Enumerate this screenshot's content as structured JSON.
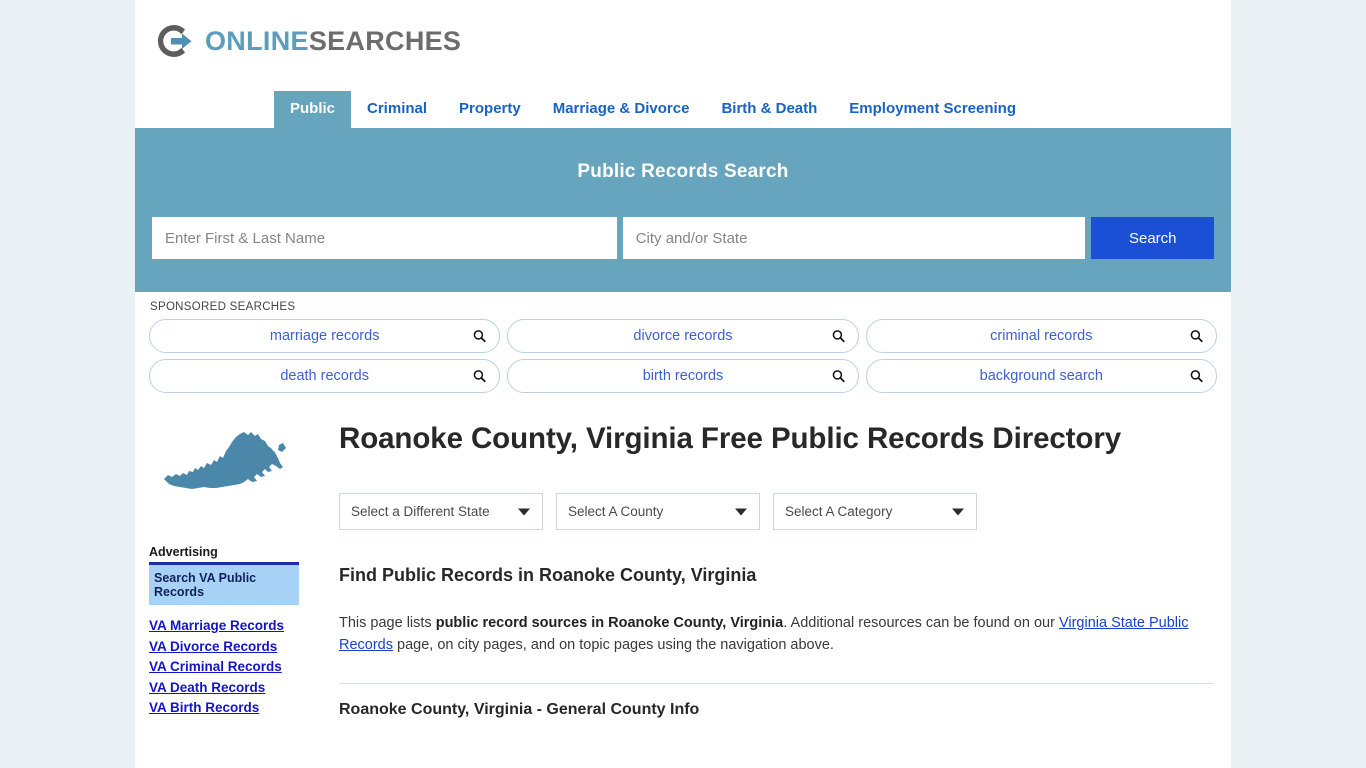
{
  "brand": {
    "logo_icon": "circle-arrow-logo-icon",
    "name_part1": "ONLINE",
    "name_part2": "SEARCHES",
    "color_online": "#5b9dbd",
    "color_searches": "#6d6d6d"
  },
  "nav": {
    "tabs": [
      {
        "label": "Public",
        "active": true
      },
      {
        "label": "Criminal",
        "active": false
      },
      {
        "label": "Property",
        "active": false
      },
      {
        "label": "Marriage & Divorce",
        "active": false
      },
      {
        "label": "Birth & Death",
        "active": false
      },
      {
        "label": "Employment Screening",
        "active": false
      }
    ],
    "active_bg": "#66a5bd",
    "link_color": "#1a62c4"
  },
  "search": {
    "title": "Public Records Search",
    "name_placeholder": "Enter First & Last Name",
    "name_value": "",
    "city_placeholder": "City and/or State",
    "city_value": "",
    "button_label": "Search",
    "band_color": "#66a5bd",
    "button_color": "#1a4fd6"
  },
  "sponsored": {
    "label": "SPONSORED SEARCHES",
    "icon": "magnifier-icon",
    "row1": [
      {
        "label": "marriage records"
      },
      {
        "label": "divorce records"
      },
      {
        "label": "criminal records"
      }
    ],
    "row2": [
      {
        "label": "death records"
      },
      {
        "label": "birth records"
      },
      {
        "label": "background search"
      }
    ]
  },
  "hero": {
    "map_icon": "virginia-state-map-icon",
    "map_color": "#4a87a8"
  },
  "page": {
    "title": "Roanoke County, Virginia Free Public Records Directory",
    "section_title": "Find Public Records in Roanoke County, Virginia",
    "intro_lead": "This page lists ",
    "intro_bold": "public record sources in Roanoke County, Virginia",
    "intro_mid": ". Additional resources can be found on our ",
    "intro_link": "Virginia State Public Records",
    "intro_tail": " page, on city pages, and on topic pages using the navigation above.",
    "sub_section": "Roanoke County, Virginia - General County Info"
  },
  "selects": [
    {
      "label": "Select a Different State",
      "name": "state"
    },
    {
      "label": "Select A County",
      "name": "county"
    },
    {
      "label": "Select A Category",
      "name": "category"
    }
  ],
  "sidebar": {
    "ad_label": "Advertising",
    "highlight": "Search VA Public Records",
    "links": [
      {
        "label": "VA Marriage Records"
      },
      {
        "label": "VA Divorce Records"
      },
      {
        "label": "VA Criminal Records"
      },
      {
        "label": "VA Death Records"
      },
      {
        "label": "VA Birth Records"
      }
    ]
  }
}
